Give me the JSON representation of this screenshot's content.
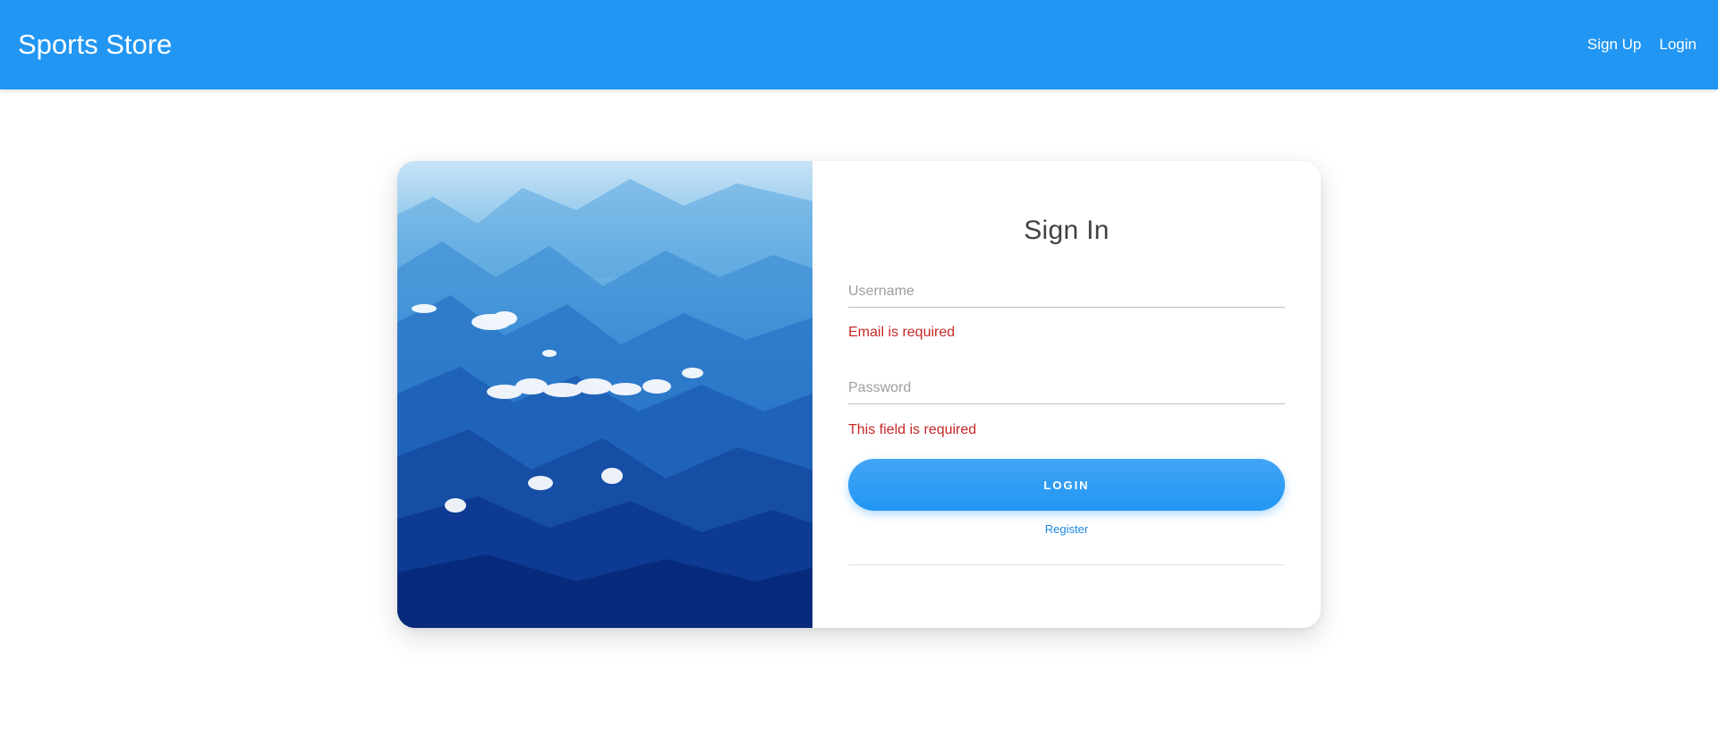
{
  "navbar": {
    "brand": "Sports Store",
    "links": [
      "Sign Up",
      "Login"
    ]
  },
  "hero": {
    "image": "mountains-with-clouds"
  },
  "form": {
    "title": "Sign In",
    "username": {
      "placeholder": "Username",
      "value": "",
      "error": "Email is required"
    },
    "password": {
      "placeholder": "Password",
      "value": "",
      "error": "This field is required"
    },
    "login_label": "LOGIN",
    "register_label": "Register"
  },
  "colors": {
    "primary": "#2196f3",
    "error": "#c62828"
  }
}
